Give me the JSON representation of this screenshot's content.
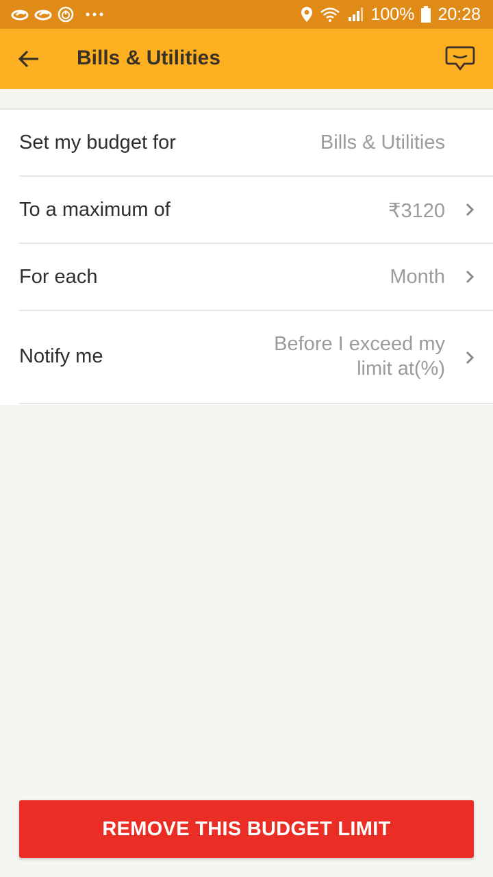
{
  "status_bar": {
    "battery": "100%",
    "time": "20:28",
    "icons": [
      "app-notification-icon",
      "app-notification-icon",
      "power-icon",
      "more-dots-icon",
      "location-pin-icon",
      "wifi-icon",
      "signal-icon",
      "battery-icon"
    ]
  },
  "app_bar": {
    "title": "Bills & Utilities",
    "back_icon": "arrow-left-icon",
    "chat_icon": "chat-bubble-icon"
  },
  "budget_rows": [
    {
      "label": "Set my budget for",
      "value": "Bills & Utilities"
    },
    {
      "label": "To a maximum of",
      "value": "₹3120"
    },
    {
      "label": "For each",
      "value": "Month"
    },
    {
      "label": "Notify me",
      "value": "Before I exceed my limit at(%)"
    }
  ],
  "remove_button": {
    "label": "REMOVE THIS BUDGET LIMIT"
  },
  "colors": {
    "status_bar": "#e08b18",
    "app_bar": "#fdb022",
    "remove_button": "#ea2e25"
  }
}
